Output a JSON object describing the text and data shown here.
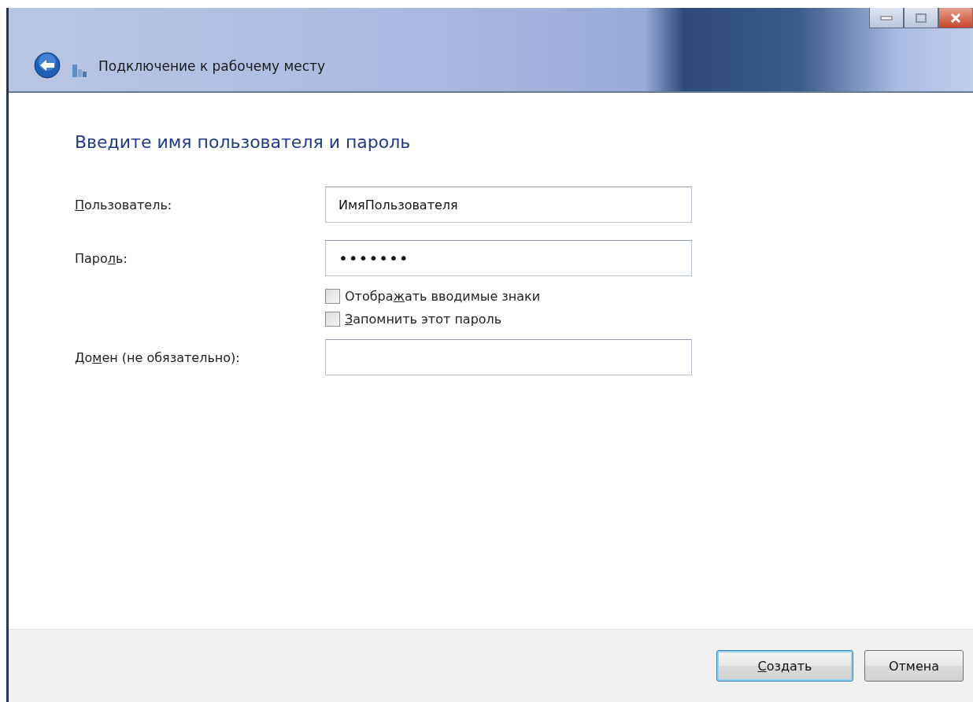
{
  "window": {
    "title": "Подключение к рабочему месту"
  },
  "heading": "Введите имя пользователя и пароль",
  "fields": [
    {
      "label": {
        "key": "П",
        "after": "ользователь:"
      },
      "value": "ИмяПользователя",
      "kind": "text"
    },
    {
      "label": {
        "before": "Паро",
        "key": "л",
        "after": "ь:"
      },
      "value": "•••••••",
      "kind": "password"
    }
  ],
  "checkboxes": [
    {
      "label": {
        "before": "Отобра",
        "key": "ж",
        "after": "ать вводимые знаки"
      },
      "checked": false
    },
    {
      "label": {
        "key": "З",
        "after": "апомнить этот пароль"
      },
      "checked": false
    }
  ],
  "domain": {
    "label": {
      "before": "До",
      "key": "м",
      "after": "ен (не обязательно):"
    }
  },
  "buttons": [
    {
      "label": {
        "key": "С",
        "after": "оздать"
      },
      "kind": "default"
    },
    {
      "label": {
        "before": "Отмена"
      },
      "kind": "normal"
    }
  ]
}
